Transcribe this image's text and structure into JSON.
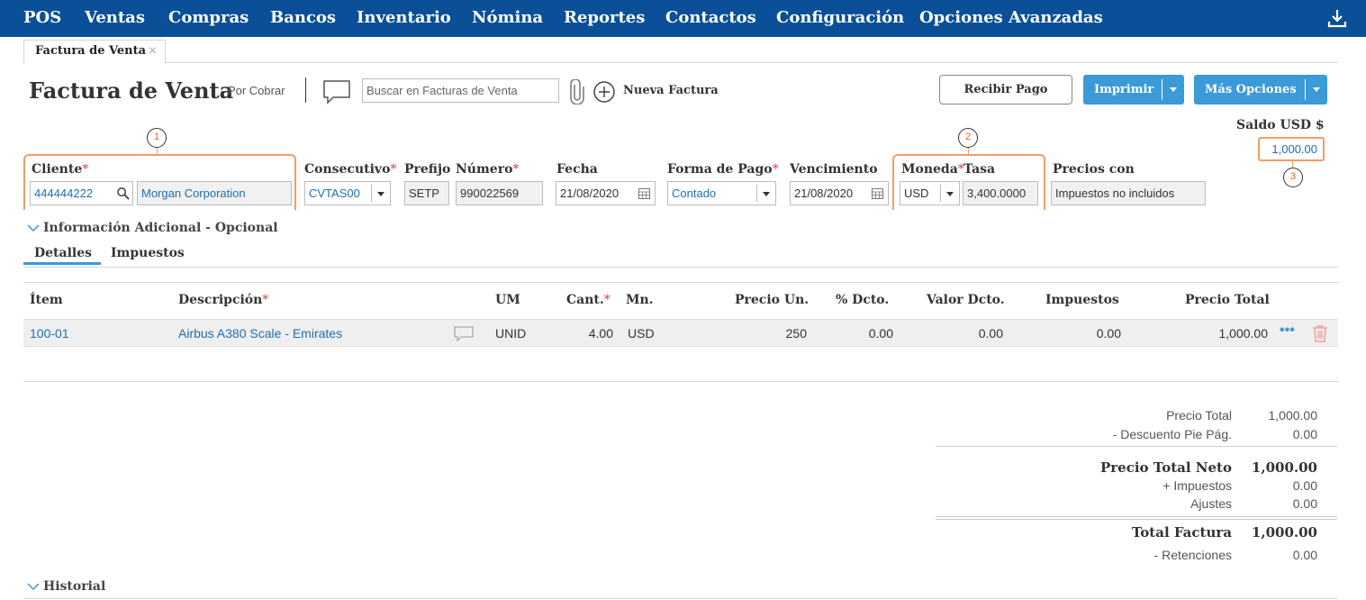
{
  "nav": {
    "items": [
      "POS",
      "Ventas",
      "Compras",
      "Bancos",
      "Inventario",
      "Nómina",
      "Reportes",
      "Contactos",
      "Configuración",
      "Opciones Avanzadas"
    ],
    "download_icon": "download-icon",
    "color": "#0a4f97"
  },
  "tab": {
    "label": "Factura de Venta",
    "close": "×"
  },
  "header": {
    "title": "Factura de Venta",
    "status": "- Por Cobrar",
    "search_placeholder": "Buscar en Facturas de Venta",
    "new_invoice": "Nueva Factura"
  },
  "actions": {
    "receive_payment": "Recibir Pago",
    "print": "Imprimir",
    "more_options": "Más Opciones"
  },
  "balance": {
    "label": "Saldo USD $",
    "value": "1,000.00"
  },
  "markers": [
    "1",
    "2",
    "3"
  ],
  "fields": {
    "cliente_label": "Cliente",
    "cliente_id": "444444222",
    "cliente_name": "Morgan Corporation",
    "consecutivo_label": "Consecutivo",
    "consecutivo_value": "CVTAS00",
    "prefijo_label": "Prefijo",
    "prefijo_value": "SETP",
    "numero_label": "Número",
    "numero_value": "990022569",
    "fecha_label": "Fecha",
    "fecha_value": "21/08/2020",
    "forma_pago_label": "Forma de Pago",
    "forma_pago_value": "Contado",
    "vencimiento_label": "Vencimiento",
    "vencimiento_value": "21/08/2020",
    "moneda_label": "Moneda",
    "moneda_value": "USD",
    "tasa_label": "Tasa",
    "tasa_value": "3,400.0000",
    "precios_label": "Precios con",
    "precios_value": "Impuestos no incluidos",
    "required_mark": "*"
  },
  "info_adicional": "Información Adicional - Opcional",
  "subtabs": [
    "Detalles",
    "Impuestos"
  ],
  "grid": {
    "headers": [
      "Ítem",
      "Descripción",
      "UM",
      "Cant.",
      "Mn.",
      "Precio Un.",
      "% Dcto.",
      "Valor Dcto.",
      "Impuestos",
      "Precio Total"
    ],
    "rows": [
      {
        "item": "100-01",
        "descripcion": "Airbus A380 Scale - Emirates",
        "um": "UNID",
        "cant": "4.00",
        "mn": "USD",
        "precio_un": "250",
        "dcto_pct": "0.00",
        "valor_dcto": "0.00",
        "impuestos": "0.00",
        "precio_total": "1,000.00",
        "more": "•••"
      }
    ]
  },
  "totals": {
    "precio_total_label": "Precio Total",
    "precio_total": "1,000.00",
    "descuento_label": "- Descuento Pie Pág.",
    "descuento": "0.00",
    "neto_label": "Precio Total Neto",
    "neto": "1,000.00",
    "impuestos_label": "+ Impuestos",
    "impuestos": "0.00",
    "ajustes_label": "Ajustes",
    "ajustes": "0.00",
    "total_label": "Total Factura",
    "total": "1,000.00",
    "retenciones_label": "- Retenciones",
    "retenciones": "0.00"
  },
  "historial": "Historial",
  "colors": {
    "accent": "#3b9ad8",
    "highlight": "#f39c63",
    "link": "#1f6fb5",
    "required": "#e0393e"
  }
}
